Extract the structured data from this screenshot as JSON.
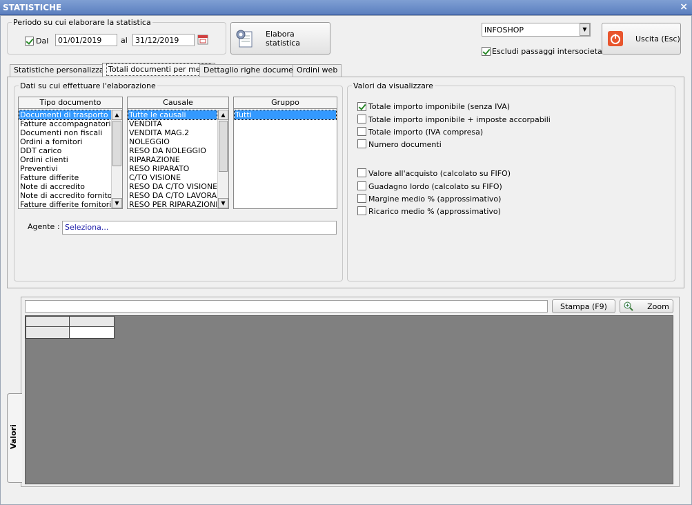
{
  "window": {
    "title": "STATISTICHE",
    "close_glyph": "×"
  },
  "period": {
    "legend": "Periodo su cui elaborare la statistica",
    "from_label": "Dal",
    "from_checked": true,
    "from_value": "01/01/2019",
    "to_label": "al",
    "to_value": "31/12/2019"
  },
  "toolbar": {
    "elabora_label": "Elabora statistica",
    "store_value": "INFOSHOP",
    "exclude_label": "Escludi passaggi intersocietari",
    "exclude_checked": true,
    "exit_label": "Uscita (Esc)"
  },
  "tabs": [
    {
      "label": "Statistiche personalizzate",
      "active": false
    },
    {
      "label": "Totali documenti per mese",
      "active": true
    },
    {
      "label": "Dettaglio righe documenti",
      "active": false
    },
    {
      "label": "Ordini web",
      "active": false
    }
  ],
  "data_section": {
    "legend": "Dati su cui effettuare l'elaborazione",
    "tipo_documento": {
      "header": "Tipo documento",
      "items": [
        "Documenti di trasporto",
        "Fatture accompagnatorie",
        "Documenti non fiscali",
        "Ordini a fornitori",
        "DDT carico",
        "Ordini clienti",
        "Preventivi",
        "Fatture differite",
        "Note di accredito",
        "Note di accredito fornitori",
        "Fatture differite fornitori"
      ],
      "selected_index": 0
    },
    "causale": {
      "header": "Causale",
      "items": [
        "Tutte le causali",
        "VENDITA",
        "VENDITA MAG.2",
        "NOLEGGIO",
        "RESO DA NOLEGGIO",
        "RIPARAZIONE",
        "RESO RIPARATO",
        "C/TO VISIONE",
        "RESO DA C/TO VISIONE",
        "RESO DA C/TO LAVORAZIO",
        "RESO PER RIPARAZIONE A"
      ],
      "selected_index": 0
    },
    "gruppo": {
      "header": "Gruppo",
      "items": [
        "Tutti"
      ],
      "selected_index": 0
    },
    "agente_label": "Agente :",
    "agente_value": "Seleziona..."
  },
  "values_section": {
    "legend": "Valori da visualizzare",
    "options": [
      {
        "label": "Totale importo imponibile (senza IVA)",
        "checked": true
      },
      {
        "label": "Totale importo imponibile + imposte accorpabili",
        "checked": false
      },
      {
        "label": "Totale importo (IVA compresa)",
        "checked": false
      },
      {
        "label": "Numero documenti",
        "checked": false
      },
      {
        "label": "Valore all'acquisto (calcolato su FIFO)",
        "checked": false
      },
      {
        "label": "Guadagno lordo (calcolato su FIFO)",
        "checked": false
      },
      {
        "label": "Margine medio % (approssimativo)",
        "checked": false
      },
      {
        "label": "Ricarico medio % (approssimativo)",
        "checked": false
      }
    ]
  },
  "results": {
    "stampa_label": "Stampa (F9)",
    "zoom_label": "Zoom",
    "side_tab_label": "Valori"
  }
}
